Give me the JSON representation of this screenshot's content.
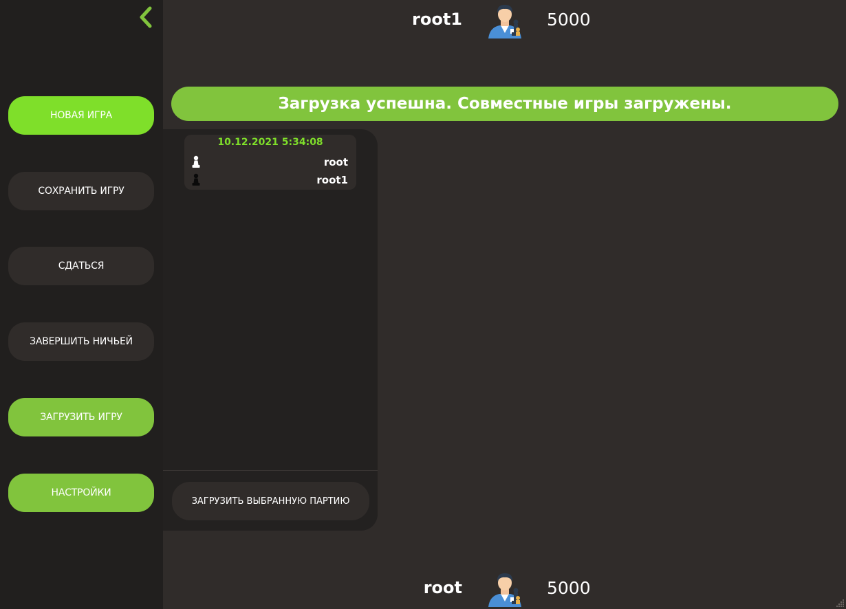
{
  "top_player": {
    "name": "root1",
    "rating": "5000",
    "avatar_icon": "chess-player-avatar-icon"
  },
  "bottom_player": {
    "name": "root",
    "rating": "5000",
    "avatar_icon": "chess-player-avatar-icon"
  },
  "sidebar": {
    "back_icon": "chevron-left-icon",
    "items": [
      {
        "label": "НОВАЯ ИГРА"
      },
      {
        "label": "СОХРАНИТЬ ИГРУ"
      },
      {
        "label": "СДАТЬСЯ"
      },
      {
        "label": "ЗАВЕРШИТЬ НИЧЬЕЙ"
      },
      {
        "label": "ЗАГРУЗИТЬ ИГРУ"
      },
      {
        "label": "НАСТРОЙКИ"
      }
    ]
  },
  "notice": {
    "text": "Загрузка успешна. Совместные игры загружены."
  },
  "games": [
    {
      "date": "10.12.2021 5:34:08",
      "white": "root",
      "black": "root1"
    }
  ],
  "load_button": {
    "label": "ЗАГРУЗИТЬ ВЫБРАННУЮ ПАРТИЮ"
  },
  "colors": {
    "accent": "#81c43d",
    "bright_accent": "#7fdf2a",
    "background": "#302c2a",
    "sidebar": "#211f1e"
  }
}
